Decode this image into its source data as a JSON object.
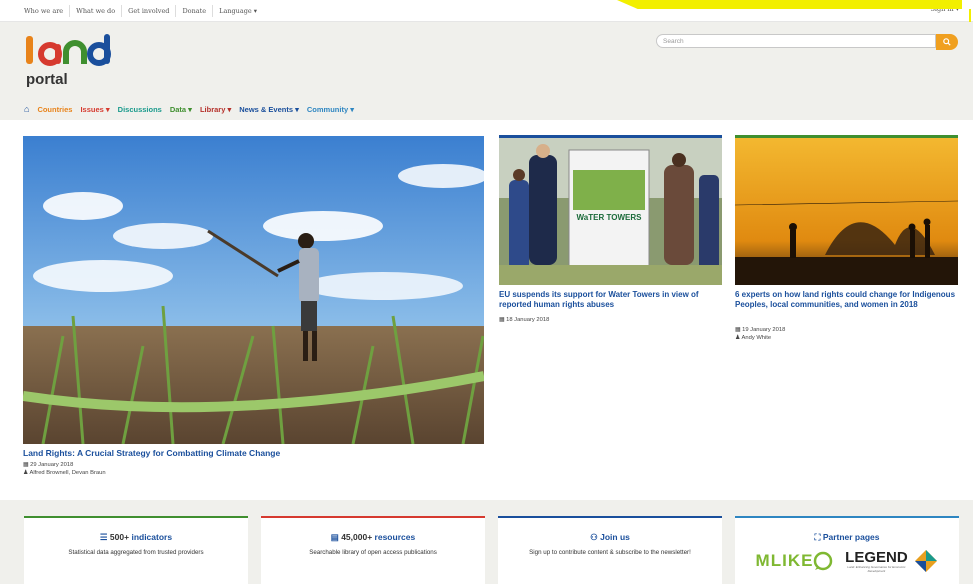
{
  "topbar": {
    "links": [
      "Who we are",
      "What we do",
      "Get involved",
      "Donate",
      "Language ▾"
    ],
    "signin": "Sign in ▾"
  },
  "search": {
    "placeholder": "Search"
  },
  "nav": {
    "items": [
      {
        "label": "Countries",
        "color": "#e8831a"
      },
      {
        "label": "Issues ▾",
        "color": "#d63a2f"
      },
      {
        "label": "Discussions",
        "color": "#1a9a8c"
      },
      {
        "label": "Data ▾",
        "color": "#3f8f2f"
      },
      {
        "label": "Library ▾",
        "color": "#b5302a"
      },
      {
        "label": "News & Events ▾",
        "color": "#1a4f9c"
      },
      {
        "label": "Community ▾",
        "color": "#2e86c1"
      }
    ]
  },
  "hero": {
    "title": "Land Rights: A Crucial Strategy for Combatting Climate Change",
    "date": "29 January 2018",
    "authors": "Alfred Brownell, Devan Braun"
  },
  "cards": [
    {
      "title": "EU suspends its support for Water Towers in view of reported human rights abuses",
      "date": "18 January 2018",
      "sign_text": "WaTER TOWERS"
    },
    {
      "title": "6 experts on how land rights could change for Indigenous Peoples, local communities, and women in 2018",
      "date": "19 January 2018",
      "author": "Andy White"
    }
  ],
  "stats": [
    {
      "count": "500+",
      "label": "indicators",
      "sub": "Statistical data aggregated from trusted providers",
      "color": "#3f8f2f"
    },
    {
      "count": "45,000+",
      "label": "resources",
      "sub": "Searchable library of open access publications",
      "color": "#d63a2f"
    },
    {
      "count": "",
      "label": "Join us",
      "sub": "Sign up to contribute content & subscribe to the newsletter!",
      "color": "#1a4f9c"
    },
    {
      "count": "",
      "label": "Partner pages",
      "sub": "",
      "color": "#2e86c1"
    }
  ],
  "partners": {
    "mliko": "MLIKE",
    "legend": "LEGEND",
    "legend_sub": "Land: Enhancing Governance for Economic Development"
  }
}
